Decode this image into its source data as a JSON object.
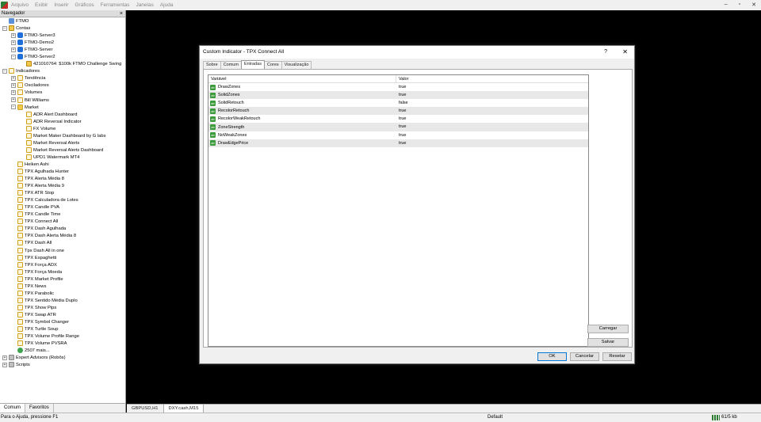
{
  "menu": [
    "Arquivo",
    "Exibir",
    "Inserir",
    "Gráficos",
    "Ferramentas",
    "Janelas",
    "Ajuda"
  ],
  "window_controls": [
    "–",
    "▫",
    "✕"
  ],
  "navigator": {
    "title": "Navegador",
    "close": "×",
    "tree": [
      {
        "label": "FTMO",
        "depth": 0,
        "ex": "",
        "icon": "root"
      },
      {
        "label": "Contas",
        "depth": 0,
        "ex": "−",
        "icon": "acct"
      },
      {
        "label": "FTMO-Server3",
        "depth": 1,
        "ex": "+",
        "icon": "server"
      },
      {
        "label": "FTMO-Demo2",
        "depth": 1,
        "ex": "+",
        "icon": "server"
      },
      {
        "label": "FTMO-Server",
        "depth": 1,
        "ex": "+",
        "icon": "server"
      },
      {
        "label": "FTMO-Server2",
        "depth": 1,
        "ex": "−",
        "icon": "server"
      },
      {
        "label": "421010764: $100k FTMO Challenge Swing",
        "depth": 2,
        "ex": "",
        "icon": "acct"
      },
      {
        "label": "Indicadores",
        "depth": 0,
        "ex": "−",
        "icon": "ind"
      },
      {
        "label": "Tendência",
        "depth": 1,
        "ex": "+",
        "icon": "ind"
      },
      {
        "label": "Osciladores",
        "depth": 1,
        "ex": "+",
        "icon": "ind"
      },
      {
        "label": "Volumes",
        "depth": 1,
        "ex": "+",
        "icon": "ind"
      },
      {
        "label": "Bill Williams",
        "depth": 1,
        "ex": "+",
        "icon": "ind"
      },
      {
        "label": "Market",
        "depth": 1,
        "ex": "−",
        "icon": "folder"
      },
      {
        "label": "ADR Alert Dashboard",
        "depth": 2,
        "ex": "",
        "icon": "ind"
      },
      {
        "label": "ADR Reversal Indicator",
        "depth": 2,
        "ex": "",
        "icon": "ind"
      },
      {
        "label": "FX Volume",
        "depth": 2,
        "ex": "",
        "icon": "ind"
      },
      {
        "label": "Market Maker Dashboard by G labs",
        "depth": 2,
        "ex": "",
        "icon": "ind"
      },
      {
        "label": "Market Reversal Alerts",
        "depth": 2,
        "ex": "",
        "icon": "ind"
      },
      {
        "label": "Market Reversal Alerts Dashboard",
        "depth": 2,
        "ex": "",
        "icon": "ind"
      },
      {
        "label": "UPD1 Watermark MT4",
        "depth": 2,
        "ex": "",
        "icon": "ind"
      },
      {
        "label": "Heiken Ashi",
        "depth": 1,
        "ex": "",
        "icon": "ind"
      },
      {
        "label": "TPX Agulhada Hunter",
        "depth": 1,
        "ex": "",
        "icon": "ind"
      },
      {
        "label": "TPX Alerta Média 8",
        "depth": 1,
        "ex": "",
        "icon": "ind"
      },
      {
        "label": "TPX Alerta Média 9",
        "depth": 1,
        "ex": "",
        "icon": "ind"
      },
      {
        "label": "TPX ATR Stop",
        "depth": 1,
        "ex": "",
        "icon": "ind"
      },
      {
        "label": "TPX Calculadora de Lotes",
        "depth": 1,
        "ex": "",
        "icon": "ind"
      },
      {
        "label": "TPX Candle PVA",
        "depth": 1,
        "ex": "",
        "icon": "ind"
      },
      {
        "label": "TPX Candle Time",
        "depth": 1,
        "ex": "",
        "icon": "ind"
      },
      {
        "label": "TPX Connect All",
        "depth": 1,
        "ex": "",
        "icon": "ind"
      },
      {
        "label": "TPX Dash Agulhada",
        "depth": 1,
        "ex": "",
        "icon": "ind"
      },
      {
        "label": "TPX Dash Alerta Média 8",
        "depth": 1,
        "ex": "",
        "icon": "ind"
      },
      {
        "label": "TPX Dash All",
        "depth": 1,
        "ex": "",
        "icon": "ind"
      },
      {
        "label": "Tpx Dash All in one",
        "depth": 1,
        "ex": "",
        "icon": "ind"
      },
      {
        "label": "TPX Espaghetti",
        "depth": 1,
        "ex": "",
        "icon": "ind"
      },
      {
        "label": "TPX Força ADX",
        "depth": 1,
        "ex": "",
        "icon": "ind"
      },
      {
        "label": "TPX Força Moeda",
        "depth": 1,
        "ex": "",
        "icon": "ind"
      },
      {
        "label": "TPX Market Profile",
        "depth": 1,
        "ex": "",
        "icon": "ind"
      },
      {
        "label": "TPX News",
        "depth": 1,
        "ex": "",
        "icon": "ind"
      },
      {
        "label": "TPX Parabolic",
        "depth": 1,
        "ex": "",
        "icon": "ind"
      },
      {
        "label": "TPX Sentido Média Duplo",
        "depth": 1,
        "ex": "",
        "icon": "ind"
      },
      {
        "label": "TPX Show Pips",
        "depth": 1,
        "ex": "",
        "icon": "ind"
      },
      {
        "label": "TPX Swap ATR",
        "depth": 1,
        "ex": "",
        "icon": "ind"
      },
      {
        "label": "TPX Symbol Changer",
        "depth": 1,
        "ex": "",
        "icon": "ind"
      },
      {
        "label": "TPX Turtle Soup",
        "depth": 1,
        "ex": "",
        "icon": "ind"
      },
      {
        "label": "TPX Volume Profile Range",
        "depth": 1,
        "ex": "",
        "icon": "ind"
      },
      {
        "label": "TPX Volume PVSRA",
        "depth": 1,
        "ex": "",
        "icon": "ind"
      },
      {
        "label": "2507 mais...",
        "depth": 1,
        "ex": "",
        "icon": "globe"
      },
      {
        "label": "Expert Advisors (Robôs)",
        "depth": 0,
        "ex": "+",
        "icon": "ea"
      },
      {
        "label": "Scripts",
        "depth": 0,
        "ex": "+",
        "icon": "ea"
      }
    ],
    "tabs": [
      "Comum",
      "Favoritos"
    ]
  },
  "chart_tabs": [
    "GBPUSD,H1",
    "DXY.cash,M15"
  ],
  "status": {
    "help": "Para o Ajuda, pressione F1",
    "profile": "Default",
    "traffic": "61/5 kb"
  },
  "dialog": {
    "title": "Custom Indicator - TPX Connect All",
    "help": "?",
    "close": "✕",
    "tabs": [
      "Sobre",
      "Comum",
      "Entradas",
      "Cores",
      "Visualização"
    ],
    "active_tab": 2,
    "col_var": "Variável",
    "col_val": "Valor",
    "inputs": [
      {
        "name": "DrawZones",
        "value": "true"
      },
      {
        "name": "SolidZones",
        "value": "true"
      },
      {
        "name": "SolidRetouch",
        "value": "false"
      },
      {
        "name": "RecolorRetouch",
        "value": "true"
      },
      {
        "name": "RecolorWeakRetouch",
        "value": "true"
      },
      {
        "name": "ZoneStrength",
        "value": "true"
      },
      {
        "name": "NoWeakZones",
        "value": "true"
      },
      {
        "name": "DrawEdgePrice",
        "value": "true"
      }
    ],
    "load_label": "Carregar",
    "save_label": "Salvar",
    "ok_label": "OK",
    "cancel_label": "Cancelar",
    "reset_label": "Resetar"
  }
}
